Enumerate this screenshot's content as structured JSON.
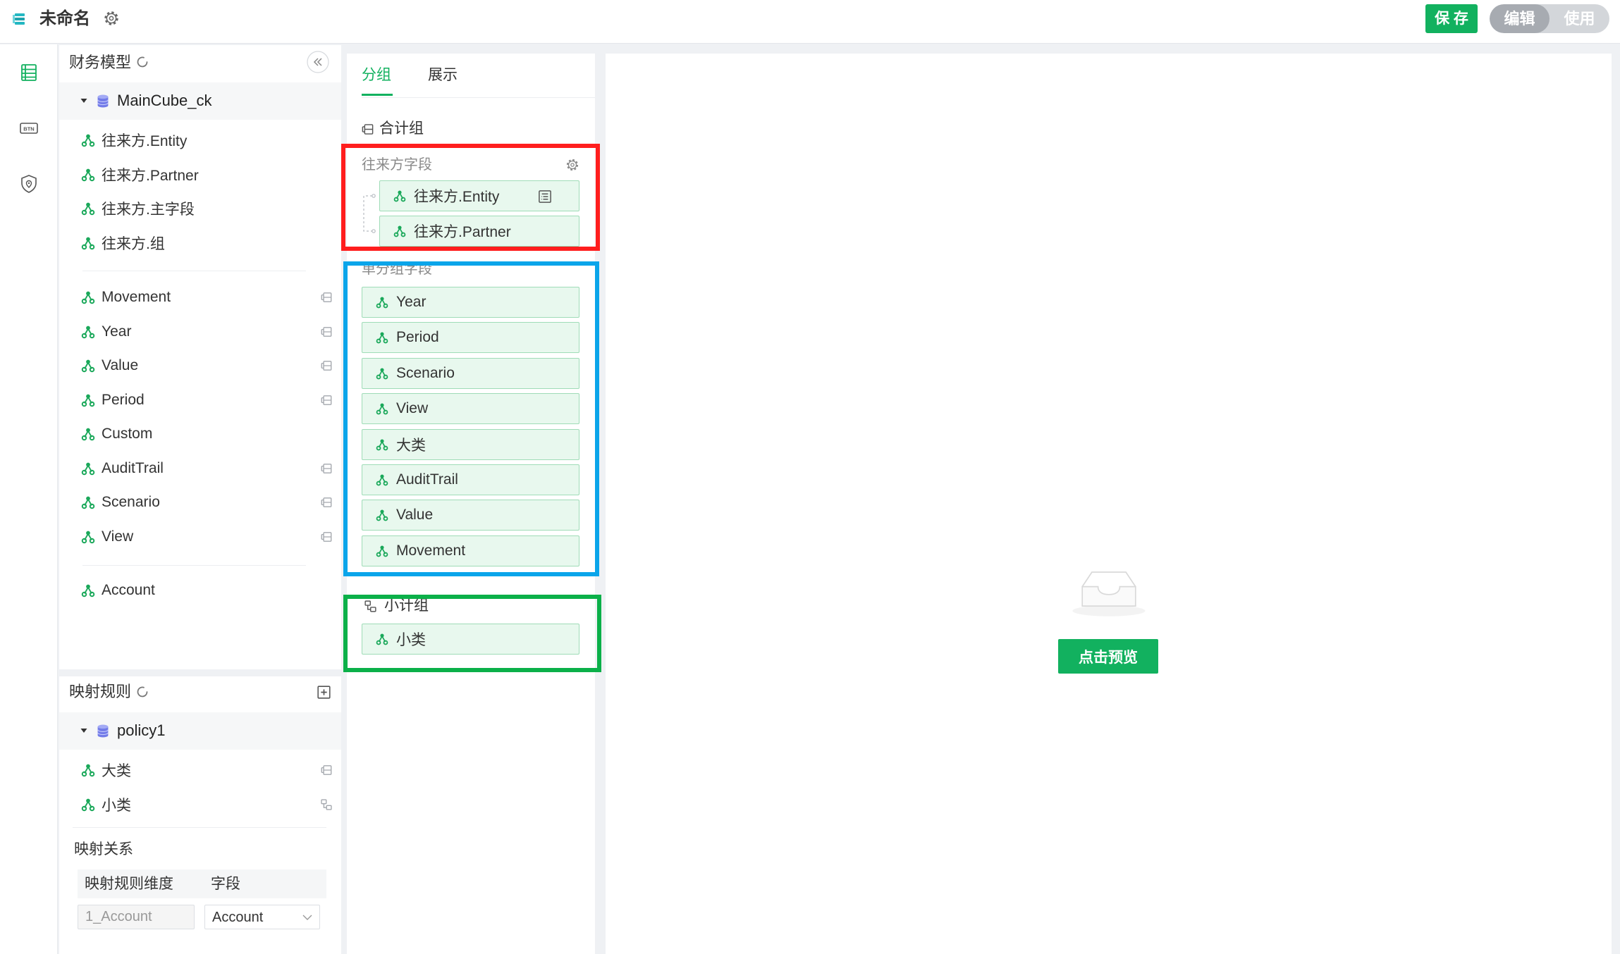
{
  "app": {
    "title": "未命名"
  },
  "colors": {
    "accent": "#12b15f",
    "tag_bg": "#e8f8ee",
    "tag_border": "#9fdcb7",
    "annotation_red": "#ff1e1e",
    "annotation_blue": "#0aa5ea",
    "annotation_green": "#0bb049"
  },
  "header": {
    "save_label": "保 存",
    "mode_edit": "编辑",
    "mode_use": "使用",
    "active_mode": "编辑"
  },
  "rail": {
    "items": [
      "table-icon",
      "btn-icon",
      "shield-location-icon"
    ],
    "active_index": 0,
    "btn_label": "BTN"
  },
  "model_panel": {
    "title": "财务模型",
    "cube": "MainCube_ck",
    "groups": [
      {
        "items": [
          {
            "label": "往来方.Entity"
          },
          {
            "label": "往来方.Partner"
          },
          {
            "label": "往来方.主字段"
          },
          {
            "label": "往来方.组"
          }
        ]
      },
      {
        "items": [
          {
            "label": "Movement",
            "icon": "group-icon"
          },
          {
            "label": "Year",
            "icon": "group-icon"
          },
          {
            "label": "Value",
            "icon": "group-icon"
          },
          {
            "label": "Period",
            "icon": "group-icon"
          },
          {
            "label": "Custom"
          },
          {
            "label": "AuditTrail",
            "icon": "group-icon"
          },
          {
            "label": "Scenario",
            "icon": "group-icon"
          },
          {
            "label": "View",
            "icon": "group-icon"
          }
        ]
      },
      {
        "items": [
          {
            "label": "Account"
          }
        ]
      }
    ]
  },
  "mapping_panel": {
    "title": "映射规则",
    "policy": "policy1",
    "items": [
      {
        "label": "大类",
        "icon": "group-icon"
      },
      {
        "label": "小类",
        "icon": "subtotal-icon"
      }
    ],
    "relation_title": "映射关系",
    "table": {
      "headers": [
        "映射规则维度",
        "字段"
      ],
      "rows": [
        {
          "dimension": "1_Account",
          "field": "Account"
        }
      ]
    }
  },
  "group_panel": {
    "tabs": [
      {
        "label": "分组",
        "active": true
      },
      {
        "label": "展示",
        "active": false
      }
    ],
    "total_group_label": "合计组",
    "partner_field": {
      "label": "往来方字段",
      "items": [
        "往来方.Entity",
        "往来方.Partner"
      ]
    },
    "single_group": {
      "label": "单分组字段",
      "items": [
        "Year",
        "Period",
        "Scenario",
        "View",
        "大类",
        "AuditTrail",
        "Value",
        "Movement"
      ]
    },
    "subtotal_group": {
      "label": "小计组",
      "items": [
        "小类"
      ]
    }
  },
  "preview": {
    "button_label": "点击预览"
  }
}
